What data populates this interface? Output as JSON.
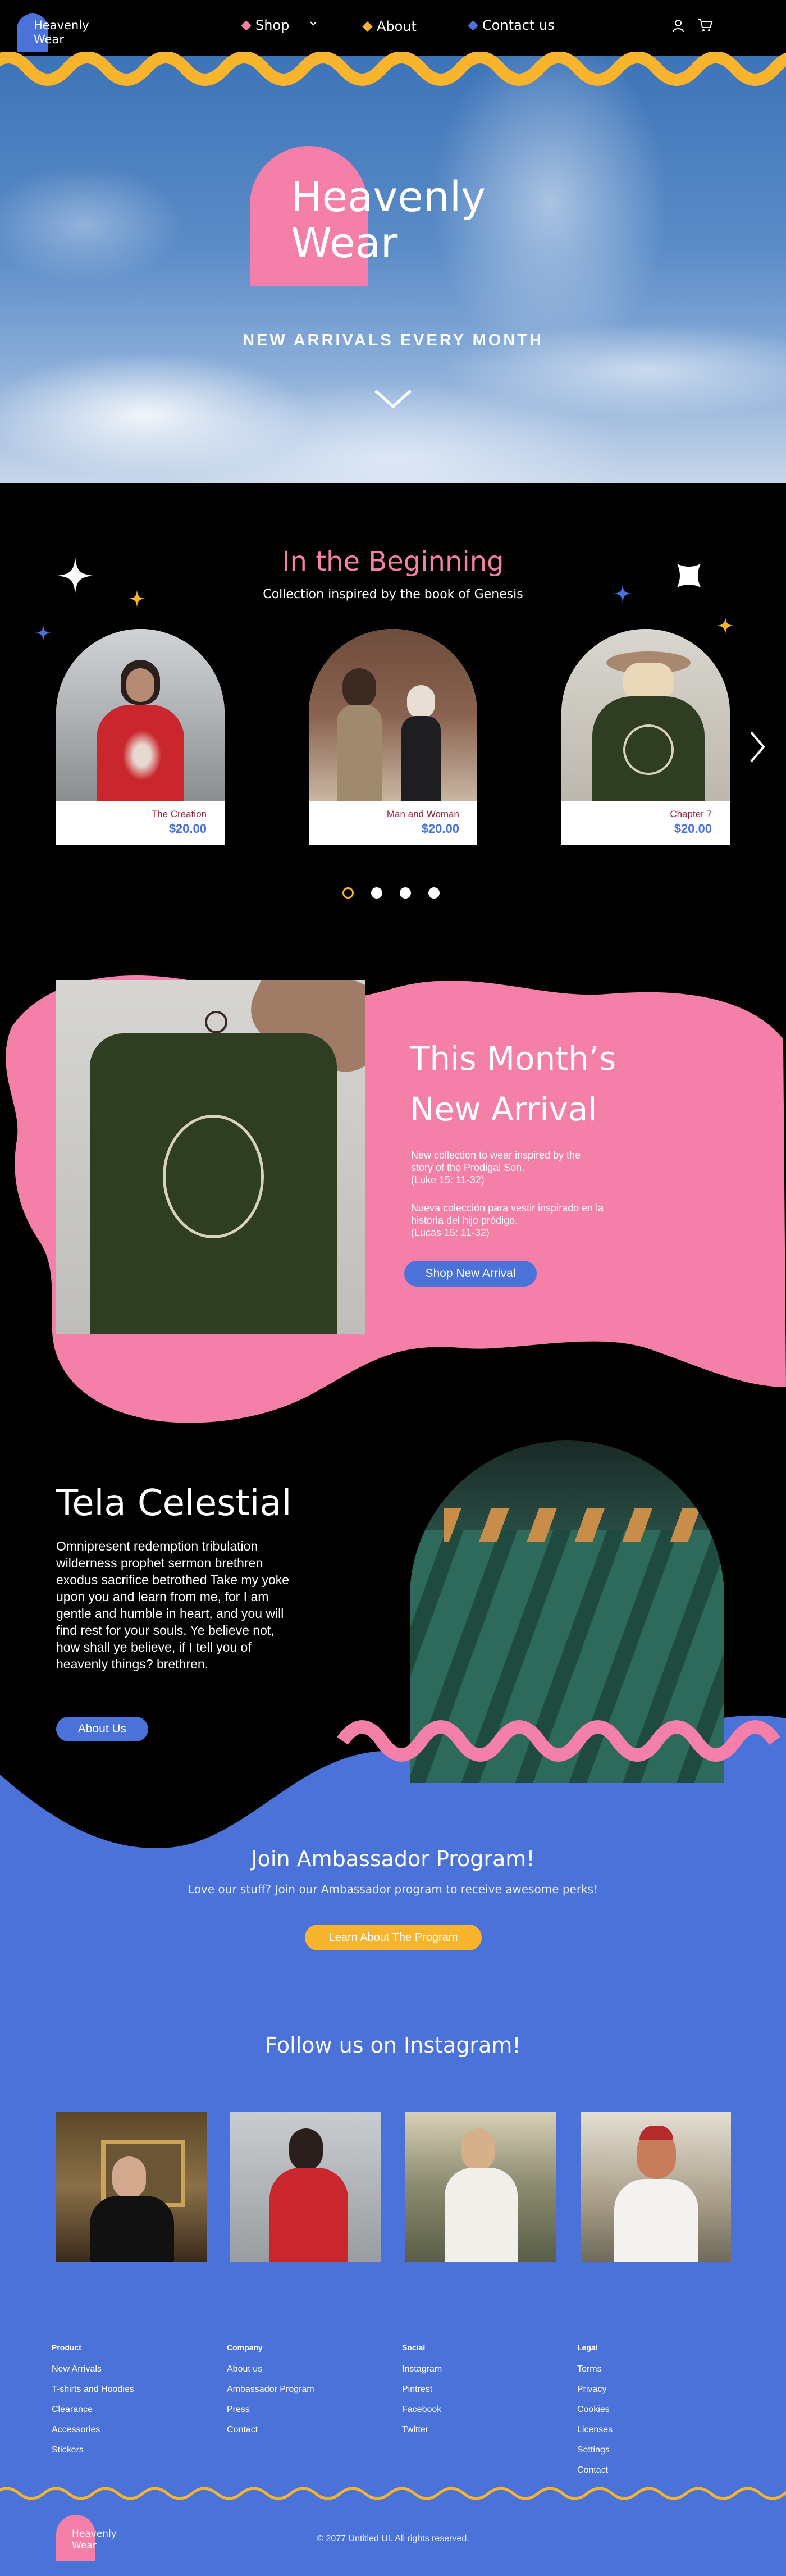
{
  "brand": {
    "logo_line1": "Heavenly",
    "logo_line2": "Wear"
  },
  "nav": {
    "items": [
      {
        "label": "Shop",
        "color": "#f47fa8"
      },
      {
        "label": "About",
        "color": "#f7b42c"
      },
      {
        "label": "Contact us",
        "color": "#4a72d8"
      }
    ],
    "icons": [
      "user-icon",
      "cart-icon",
      "chevron-down-icon"
    ]
  },
  "hero": {
    "title_line1": "Heavenly",
    "title_line2": "Wear",
    "subtitle": "NEW ARRIVALS EVERY MONTH"
  },
  "collection": {
    "title": "In the Beginning",
    "subtitle": "Collection inspired by the book of Genesis",
    "products": [
      {
        "name": "The Creation",
        "price": "$20.00"
      },
      {
        "name": "Man and Woman",
        "price": "$20.00"
      },
      {
        "name": "Chapter 7",
        "price": "$20.00"
      }
    ],
    "pager": {
      "count": 4,
      "active": 1
    }
  },
  "new_arrival": {
    "title_line1": "This Month’s",
    "title_line2": "New Arrival",
    "text_en_1": "New collection to wear inspired by the",
    "text_en_2": "story of the Prodigal Son.",
    "text_en_3": "(Luke 15: 11-32)",
    "text_es_1": "Nueva colección para vestir inspirado en la",
    "text_es_2": "historia del hijo pródigo.",
    "text_es_3": "(Lucas 15: 11-32)",
    "button": "Shop New Arrival"
  },
  "tela": {
    "title": "Tela Celestial",
    "body": "Omnipresent redemption tribulation wilderness prophet sermon brethren exodus sacrifice betrothed Take my yoke upon you and learn from me, for I am gentle and humble in heart, and you will find rest for your souls. Ye believe not, how shall ye believe, if I tell you of heavenly things? brethren.",
    "button": "About Us"
  },
  "ambassador": {
    "title": "Join Ambassador Program!",
    "text": "Love our stuff? Join our Ambassador program to receive awesome perks!",
    "button": "Learn About The Program"
  },
  "instagram": {
    "title": "Follow us on Instagram!"
  },
  "footer": {
    "columns": [
      {
        "heading": "Product",
        "items": [
          "New Arrivals",
          "T-shirts and Hoodies",
          "Clearance",
          "Accessories",
          "Stickers"
        ]
      },
      {
        "heading": "Company",
        "items": [
          "About us",
          "Ambassador Program",
          "Press",
          "Contact"
        ]
      },
      {
        "heading": "Social",
        "items": [
          "Instagram",
          "Pintrest",
          "Facebook",
          "Twitter"
        ]
      },
      {
        "heading": "Legal",
        "items": [
          "Terms",
          "Privacy",
          "Cookies",
          "Licenses",
          "Settings",
          "Contact"
        ]
      }
    ],
    "copyright": "© 2077 Untitled UI. All rights reserved."
  },
  "colors": {
    "pink": "#f47fa8",
    "yellow": "#f7b42c",
    "blue": "#4a72d8",
    "black": "#000000"
  }
}
